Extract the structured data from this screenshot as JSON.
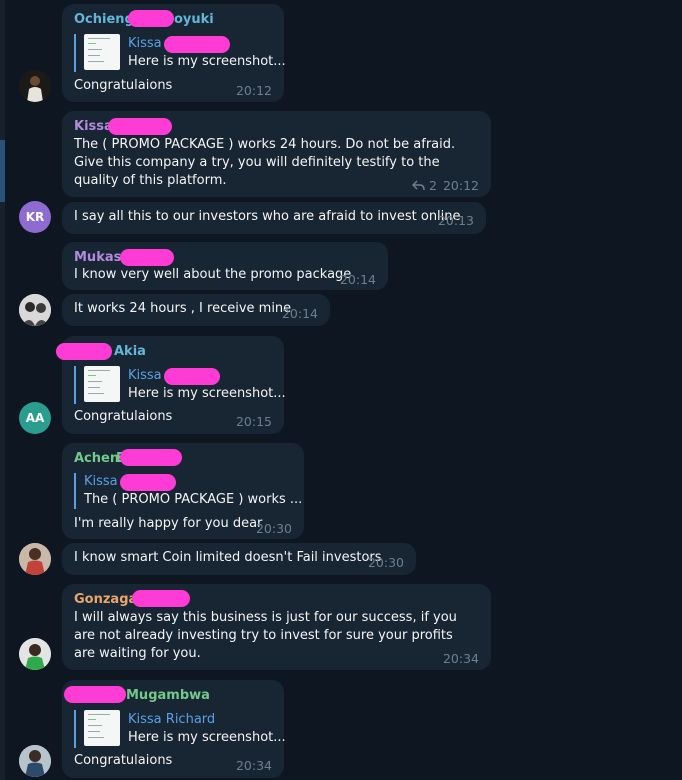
{
  "colors": {
    "background": "#0e1621",
    "bubble": "#182533",
    "accent_blue": "#5aa0e6",
    "name_teal": "#64b5d9",
    "name_purple": "#b38bdc",
    "name_green": "#73c98c",
    "name_orange": "#e9a66a",
    "redaction": "#ff3bd6",
    "time": "#6d7f8f"
  },
  "messages": [
    {
      "sender": "Ochieng",
      "sender_suffix": "oyuki",
      "reply_name": "Kissa",
      "reply_text": "Here is my screenshot...",
      "text": "Congratulaions",
      "time": "20:12"
    },
    {
      "sender": "Kissa",
      "text": "The ( PROMO PACKAGE ) works 24 hours. Do not be afraid.  Give this company a try, you will definitely testify to the quality of this platform.",
      "reply_count": "2",
      "reply_icon": "reply-arrow-icon",
      "time": "20:12"
    },
    {
      "text": "I say all this to our investors who are afraid to invest online",
      "time": "20:13",
      "avatar_initials": "KR"
    },
    {
      "sender": "Mukasa",
      "text": "I know very well about the promo package",
      "time": "20:14"
    },
    {
      "text": "It works 24 hours , I receive mine",
      "time": "20:14"
    },
    {
      "sender_suffix": "Akia",
      "reply_name": "Kissa",
      "reply_text": "Here is my screenshot...",
      "text": "Congratulaions",
      "time": "20:15",
      "avatar_initials": "AA"
    },
    {
      "sender": "Achen",
      "sender_suffix": "E",
      "reply_name": "Kissa",
      "reply_text": "The ( PROMO PACKAGE ) works ...",
      "text": "I'm really happy for you dear",
      "time": "20:30"
    },
    {
      "text": "I know smart Coin limited doesn't Fail investors",
      "time": "20:30"
    },
    {
      "sender": "Gonzaga",
      "text": "I will always say this business is just for our success, if you are not already investing try to invest for sure your profits are waiting for you.",
      "time": "20:34"
    },
    {
      "sender_suffix": "Mugambwa",
      "reply_name": "Kissa Richard",
      "reply_text": "Here is my screenshot...",
      "text": "Congratulaions",
      "time": "20:34"
    }
  ]
}
